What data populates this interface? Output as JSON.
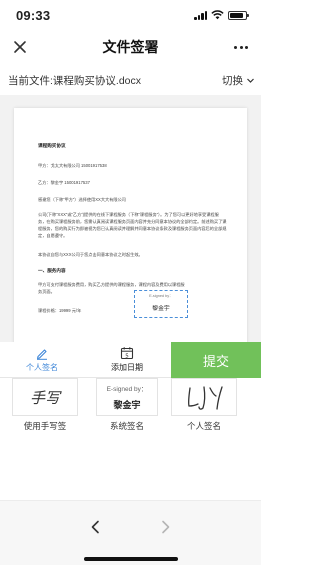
{
  "status_bar": {
    "time": "09:33"
  },
  "nav": {
    "title": "文件签署"
  },
  "file_bar": {
    "current_file": "当前文件:课程购买协议.docx",
    "switch_label": "切换"
  },
  "document": {
    "title": "课程购买协议",
    "party_a": "甲方：戈太大有限公司  15001917538",
    "party_b": "乙方：黎金宇  15001917537",
    "intro": "感谢您（下称“甲方”）选择使用XX大大有限公司",
    "para1": "公司(下称“XXX”或“乙方”)提供的在线下课程服务（下称“课程服务”）。为了您可以更好地享受课程服务，在购买课程服务前，您需认真阅读课程服务页面内容并充分同意本协议的全部约定。前述购买了课程服务，您的购买行为即被视为您已认真阅读并理解并同意本协议条款及课程服务页面内容后的全部规定，自愿遵守。",
    "para2": "本协议自您与XXX公司于您点击同意本协议之时起生效。",
    "section1": "一、服务内容",
    "para3": "甲方可支付课程服务费用，购买乙方提供的课程服务，课程内容及费用以课程服务页面。",
    "fee": "课程价格：19999 元/年",
    "sig_label": "E-signed by：",
    "sig_name": "黎金宇"
  },
  "toolbar": {
    "personal_sign_label": "个人签名",
    "add_date_label": "添加日期",
    "date_icon_day": "5",
    "submit_label": "提交"
  },
  "sig_options": {
    "handwrite_text": "手写",
    "handwrite_caption": "使用手写签",
    "system_small": "E-signed by：",
    "system_name": "黎金宇",
    "system_caption": "系统签名",
    "personal_caption": "个人签名"
  },
  "colors": {
    "accent_green": "#71c15a",
    "accent_blue": "#3d86d8"
  }
}
